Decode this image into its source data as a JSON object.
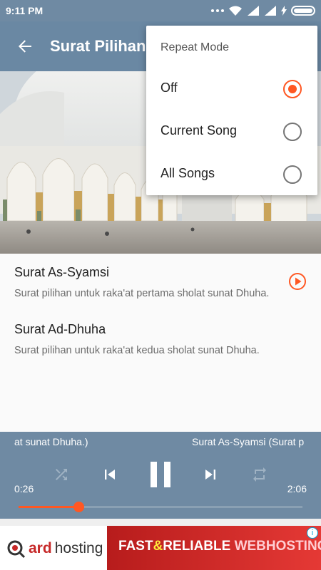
{
  "status_bar": {
    "time": "9:11 PM"
  },
  "app_bar": {
    "title": "Surat Pilihan"
  },
  "surah_list": [
    {
      "title": "Surat As-Syamsi",
      "subtitle": "Surat pilihan untuk raka'at pertama sholat sunat Dhuha."
    },
    {
      "title": "Surat Ad-Dhuha",
      "subtitle": "Surat pilihan untuk raka'at kedua sholat sunat Dhuha."
    }
  ],
  "player": {
    "marquee_left": "at sunat Dhuha.)",
    "marquee_right": "Surat As-Syamsi (Surat p",
    "current_time": "0:26",
    "total_time": "2:06",
    "progress": 0.21
  },
  "repeat_menu": {
    "title": "Repeat Mode",
    "options": [
      {
        "label": "Off",
        "selected": true
      },
      {
        "label": "Current Song",
        "selected": false
      },
      {
        "label": "All Songs",
        "selected": false
      }
    ]
  },
  "ad": {
    "brand_a": "ard",
    "brand_b": "hosting",
    "slogan_fast": "FAST",
    "slogan_amp": "&",
    "slogan_reliable": "RELIABLE",
    "slogan_web": "WEBHOSTING",
    "info": "i"
  },
  "colors": {
    "primary": "#6a88a3",
    "accent": "#ff5722"
  },
  "icons": [
    "back-arrow-icon",
    "play-circle-icon",
    "shuffle-icon",
    "skip-previous-icon",
    "pause-icon",
    "skip-next-icon",
    "repeat-icon",
    "wifi-icon",
    "signal-icon",
    "battery-icon"
  ]
}
